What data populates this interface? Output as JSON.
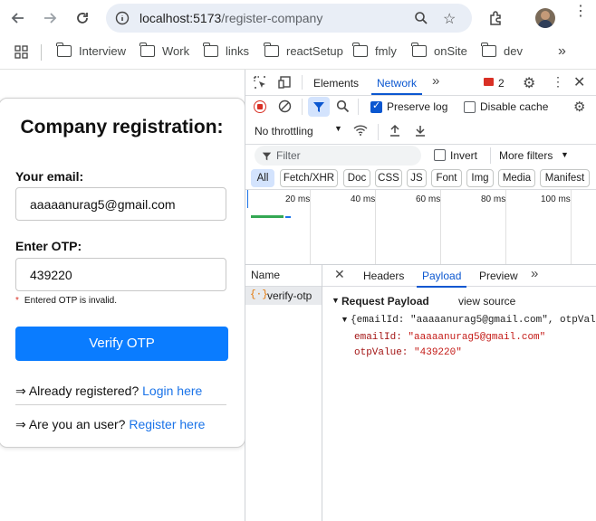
{
  "browser": {
    "url_host": "localhost:5173",
    "url_path": "/register-company",
    "bookmarks": [
      "Interview",
      "Work",
      "links",
      "reactSetup",
      "fmly",
      "onSite",
      "dev"
    ]
  },
  "form": {
    "title": "Company registration:",
    "email_label": "Your email:",
    "email_value": "aaaaanurag5@gmail.com",
    "otp_label": "Enter OTP:",
    "otp_value": "439220",
    "error": "Entered OTP is invalid.",
    "verify_button": "Verify OTP",
    "already_text": "⇒ Already registered? ",
    "login_link": "Login here",
    "user_text": "⇒ Are you an user? ",
    "register_link": "Register here"
  },
  "devtools": {
    "tabs": [
      "Elements",
      "Network"
    ],
    "error_count": "2",
    "preserve_log": "Preserve log",
    "disable_cache": "Disable cache",
    "throttling": "No throttling",
    "filter_placeholder": "Filter",
    "invert": "Invert",
    "more_filters": "More filters",
    "chips": [
      "All",
      "Fetch/XHR",
      "Doc",
      "CSS",
      "JS",
      "Font",
      "Img",
      "Media",
      "Manifest"
    ],
    "timeline_labels": [
      "20 ms",
      "40 ms",
      "60 ms",
      "80 ms",
      "100 ms"
    ],
    "name_header": "Name",
    "request_name": "verify-otp",
    "detail_tabs": [
      "Headers",
      "Payload",
      "Preview"
    ],
    "request_payload": "Request Payload",
    "view_source": "view source",
    "payload_summary": "{emailId: \"aaaaanurag5@gmail.com\", otpVal",
    "payload_email_key": "emailId:",
    "payload_email_val": "\"aaaaanurag5@gmail.com\"",
    "payload_otp_key": "otpValue:",
    "payload_otp_val": "\"439220\""
  },
  "colors": {
    "accent": "#0a7cff",
    "devtools_blue": "#0b57d0",
    "error": "#d93025"
  }
}
